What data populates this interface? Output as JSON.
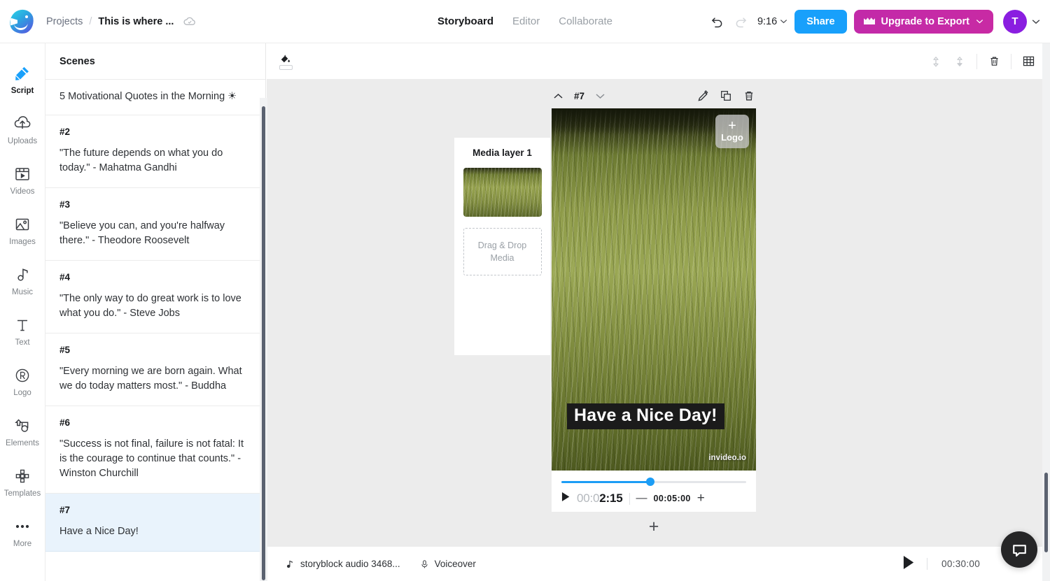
{
  "header": {
    "logo_icon": "invideo-logo-icon",
    "breadcrumb": {
      "projects": "Projects",
      "separator": "/",
      "title": "This is where ...",
      "cloud_icon": "cloud-saved-icon"
    },
    "tabs": [
      {
        "label": "Storyboard",
        "active": true
      },
      {
        "label": "Editor",
        "active": false
      },
      {
        "label": "Collaborate",
        "active": false
      }
    ],
    "undo_icon": "undo-arrow-icon",
    "redo_icon": "redo-arrow-icon",
    "duration": "9:16",
    "duration_chevron_icon": "chevron-down-icon",
    "share_label": "Share",
    "upgrade_label": "Upgrade to Export",
    "upgrade_icon": "crown-icon",
    "upgrade_chevron_icon": "chevron-down-icon",
    "avatar_initial": "T",
    "avatar_chevron_icon": "chevron-down-icon",
    "accent_share": "#18a0fb",
    "accent_upgrade": "#c62aa8",
    "accent_avatar": "#8a1ee0"
  },
  "rail": {
    "items": [
      {
        "label": "Script",
        "icon": "script-pen-icon",
        "active": true
      },
      {
        "label": "Uploads",
        "icon": "cloud-upload-icon",
        "active": false
      },
      {
        "label": "Videos",
        "icon": "video-clip-icon",
        "active": false
      },
      {
        "label": "Images",
        "icon": "image-picture-icon",
        "active": false
      },
      {
        "label": "Music",
        "icon": "music-note-icon",
        "active": false
      },
      {
        "label": "Text",
        "icon": "text-t-icon",
        "active": false
      },
      {
        "label": "Logo",
        "icon": "registered-r-icon",
        "active": false
      },
      {
        "label": "Elements",
        "icon": "shapes-elements-icon",
        "active": false
      },
      {
        "label": "Templates",
        "icon": "templates-grid-icon",
        "active": false
      },
      {
        "label": "More",
        "icon": "ellipsis-more-icon",
        "active": false
      }
    ]
  },
  "scenes_panel": {
    "title": "Scenes",
    "scenes": [
      {
        "num": "",
        "text": "5 Motivational Quotes in the Morning ☀",
        "selected": false,
        "first": true
      },
      {
        "num": "#2",
        "text": "\"The future depends on what you do today.\" - Mahatma Gandhi",
        "selected": false
      },
      {
        "num": "#3",
        "text": "\"Believe you can, and you're halfway there.\" - Theodore Roosevelt",
        "selected": false
      },
      {
        "num": "#4",
        "text": "\"The only way to do great work is to love what you do.\" - Steve Jobs",
        "selected": false
      },
      {
        "num": "#5",
        "text": "\"Every morning we are born again. What we do today matters most.\" - Buddha",
        "selected": false
      },
      {
        "num": "#6",
        "text": "\"Success is not final, failure is not fatal: It is the courage to continue that counts.\" - Winston Churchill",
        "selected": false
      },
      {
        "num": "#7",
        "text": "Have a Nice Day!",
        "selected": true
      }
    ]
  },
  "canvas_toolbar": {
    "fill_tool_icon": "paint-bucket-icon",
    "move_up_icon": "move-up-icon",
    "move_down_icon": "move-down-icon",
    "delete_icon": "trash-icon",
    "grid_icon": "grid-layout-icon"
  },
  "scene_controls": {
    "prev_icon": "chevron-up-icon",
    "scene_number": "#7",
    "next_icon": "chevron-down-icon",
    "edit_icon": "pencil-edit-icon",
    "duplicate_icon": "duplicate-copy-icon",
    "delete_icon": "trash-icon"
  },
  "media_panel": {
    "title": "Media layer 1",
    "thumb_name": "grass-field-thumbnail",
    "dropzone_line1": "Drag & Drop",
    "dropzone_line2": "Media"
  },
  "preview": {
    "logo_placeholder_plus": "+",
    "logo_placeholder_label": "Logo",
    "overlay_text": "Have a Nice Day!",
    "watermark": "invideo.io",
    "progress_percent": 48,
    "progress_accent": "#1c9df5",
    "play_icon": "play-triangle-icon",
    "current_time_dim": "00:0",
    "current_time_lit": "2:15",
    "minus_icon": "—",
    "duration": "00:05:00",
    "plus_icon": "+"
  },
  "add_scene": {
    "icon": "plus-icon",
    "label": "+"
  },
  "bottom_bar": {
    "audio_icon": "music-note-icon",
    "audio_label": "storyblock audio 3468...",
    "voiceover_icon": "microphone-icon",
    "voiceover_label": "Voiceover",
    "play_icon": "play-triangle-icon",
    "total_duration": "00:30:00"
  },
  "chat": {
    "icon": "chat-bubble-icon"
  }
}
